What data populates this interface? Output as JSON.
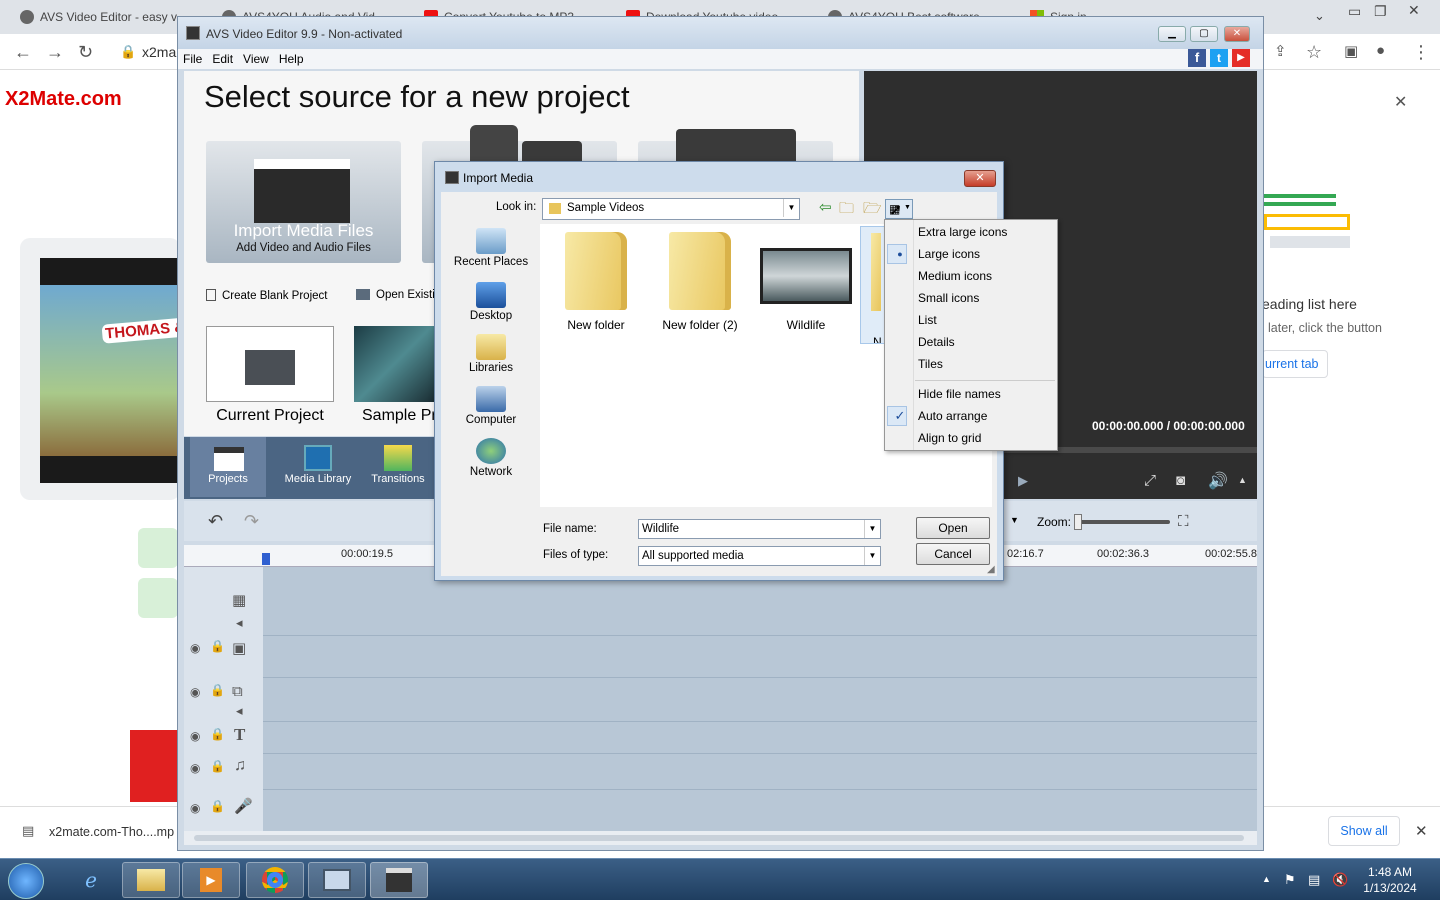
{
  "browser": {
    "tabs": [
      {
        "label": "AVS Video Editor - easy v"
      },
      {
        "label": "AVS4YOU Audio and Vid"
      },
      {
        "label": "Convert Youtube to MP3"
      },
      {
        "label": "Download Youtube video"
      },
      {
        "label": "AVS4YOU Best software"
      },
      {
        "label": "Sign in"
      }
    ],
    "url_text": "x2ma",
    "page_left_brand": "X2Mate.com",
    "page_left_thumb_text": "THOMAS & FRIENDS",
    "reading_list": {
      "heading": "eading list here",
      "sub": "later, click the button",
      "button": "urrent tab"
    },
    "download": {
      "file": "x2mate.com-Tho....mp",
      "show_all": "Show all"
    }
  },
  "avs": {
    "title": "AVS Video Editor 9.9 - Non-activated",
    "menu": [
      "File",
      "Edit",
      "View",
      "Help"
    ],
    "select_title": "Select source for a new project",
    "import_tile": {
      "title": "Import Media Files",
      "subtitle": "Add Video and Audio Files"
    },
    "create_blank": "Create Blank Project",
    "open_existing": "Open Existin",
    "current_project": "Current Project",
    "sample_project": "Sample Pr",
    "nav_tabs": [
      "Projects",
      "Media Library",
      "Transitions"
    ],
    "timecode": "00:00:00.000  /  00:00:00.000",
    "zoom_label": "Zoom:",
    "ruler": [
      "00:00:19.5",
      "02:16.7",
      "00:02:36.3",
      "00:02:55.8"
    ]
  },
  "dialog": {
    "title": "Import Media",
    "look_in_label": "Look in:",
    "look_in_value": "Sample Videos",
    "places": [
      "Recent Places",
      "Desktop",
      "Libraries",
      "Computer",
      "Network"
    ],
    "files": [
      {
        "name": "New folder"
      },
      {
        "name": "New folder (2)"
      },
      {
        "name": "Wildlife"
      },
      {
        "name": "N"
      }
    ],
    "file_name_label": "File name:",
    "file_name_value": "Wildlife",
    "files_of_type_label": "Files of type:",
    "files_of_type_value": "All supported media",
    "open_button": "Open",
    "cancel_button": "Cancel"
  },
  "view_menu": {
    "items": [
      {
        "label": "Extra large icons",
        "mark": ""
      },
      {
        "label": "Large icons",
        "mark": "●"
      },
      {
        "label": "Medium icons",
        "mark": ""
      },
      {
        "label": "Small icons",
        "mark": ""
      },
      {
        "label": "List",
        "mark": ""
      },
      {
        "label": "Details",
        "mark": ""
      },
      {
        "label": "Tiles",
        "mark": ""
      },
      {
        "label": "Hide file names",
        "mark": ""
      },
      {
        "label": "Auto arrange",
        "mark": "✓"
      },
      {
        "label": "Align to grid",
        "mark": ""
      }
    ]
  },
  "taskbar": {
    "time": "1:48 AM",
    "date": "1/13/2024"
  }
}
